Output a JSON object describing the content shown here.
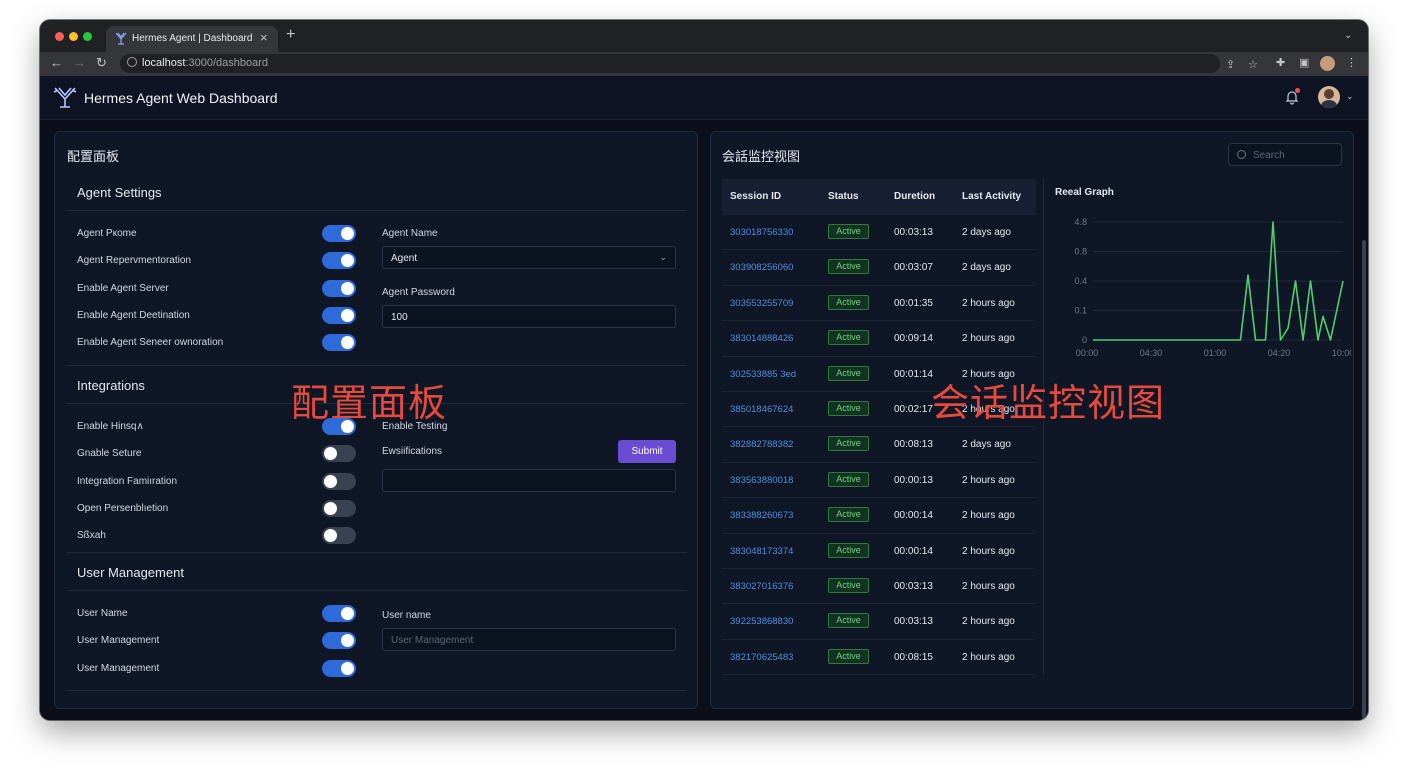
{
  "browser": {
    "tab_title": "Hermes Agent | Dashboard",
    "tab_close": "×",
    "new_tab": "+",
    "url_host": "localhost",
    "url_path": ":3000/dashboard"
  },
  "header": {
    "title": "Hermes Agent Web Dashboard"
  },
  "config_panel": {
    "title": "配置面板",
    "overlay_label": "配置面板",
    "agent_settings": {
      "title": "Agent Settings",
      "toggles": [
        {
          "label": "Agent Pкоme",
          "on": true
        },
        {
          "label": "Agent Repervmentoration",
          "on": true
        },
        {
          "label": "Enable Agent Server",
          "on": true
        },
        {
          "label": "Enable Agent Deetination",
          "on": true
        },
        {
          "label": "Enable Agent Seneer ownoration",
          "on": true
        }
      ],
      "agent_name_label": "Agent Name",
      "agent_name_value": "Agent",
      "agent_password_label": "Agent Password",
      "agent_password_value": "100"
    },
    "integrations": {
      "title": "Integrations",
      "toggles": [
        {
          "label": "Enable Hinsq∧",
          "on": true
        },
        {
          "label": "Gnable Seture",
          "on": false
        },
        {
          "label": "Integration Famiıration",
          "on": false
        },
        {
          "label": "Open Persenblıetion",
          "on": false
        },
        {
          "label": "Sßxah",
          "on": false
        }
      ],
      "enable_testing_label": "Enable Testing",
      "ewsiifications_label": "Ewsiifications",
      "submit_label": "Submit",
      "notes_value": ""
    },
    "user_management": {
      "title": "User Management",
      "toggles": [
        {
          "label": "User Name",
          "on": true
        },
        {
          "label": "User Management",
          "on": true
        },
        {
          "label": "User Management",
          "on": true
        }
      ],
      "user_name_label": "User name",
      "user_name_placeholder": "User Management"
    }
  },
  "session_panel": {
    "title": "会話监控视图",
    "overlay_label": "会话监控视图",
    "search_placeholder": "Search",
    "columns": [
      "Session ID",
      "Status",
      "Duretion",
      "Last Activity"
    ],
    "rows": [
      {
        "id": "303018756330",
        "status": "Active",
        "duration": "00:03:13",
        "last": "2 days ago"
      },
      {
        "id": "303908256060",
        "status": "Active",
        "duration": "00:03:07",
        "last": "2 days ago"
      },
      {
        "id": "303553255709",
        "status": "Active",
        "duration": "00:01:35",
        "last": "2 hours ago"
      },
      {
        "id": "383014888426",
        "status": "Active",
        "duration": "00:09:14",
        "last": "2 hours ago"
      },
      {
        "id": "302533885 3ed",
        "status": "Active",
        "duration": "00:01:14",
        "last": "2 hours ago"
      },
      {
        "id": "385018467624",
        "status": "Active",
        "duration": "00:02:17",
        "last": "2 hours ago"
      },
      {
        "id": "382882788382",
        "status": "Active",
        "duration": "00:08:13",
        "last": "2 days ago"
      },
      {
        "id": "383563880018",
        "status": "Active",
        "duration": "00:00:13",
        "last": "2 hours ago"
      },
      {
        "id": "383388260673",
        "status": "Active",
        "duration": "00:00:14",
        "last": "2 hours ago"
      },
      {
        "id": "383048173374",
        "status": "Active",
        "duration": "00:00:14",
        "last": "2 hours ago"
      },
      {
        "id": "383027016376",
        "status": "Active",
        "duration": "00:03:13",
        "last": "2 hours ago"
      },
      {
        "id": "392253868830",
        "status": "Active",
        "duration": "00:03:13",
        "last": "2 hours ago"
      },
      {
        "id": "382170625483",
        "status": "Active",
        "duration": "00:08:15",
        "last": "2 hours ago"
      }
    ],
    "graph_title": "Reeal Graph",
    "colors": {
      "accent": "#2e6bd8",
      "graph_line": "#4fce6a",
      "submit": "#6a4bd4",
      "overlay": "#e64a3c"
    }
  },
  "chart_data": {
    "type": "line",
    "title": "Reeal Graph",
    "y_ticks": [
      "4.8",
      "0.8",
      "0.4",
      "0.1",
      "0"
    ],
    "x_ticks": [
      "00:00",
      "04:30",
      "01:00",
      "04:20",
      "10:00"
    ],
    "series": [
      {
        "values": [
          [
            0,
            0.0
          ],
          [
            0.59,
            0.0
          ],
          [
            0.62,
            0.55
          ],
          [
            0.65,
            0.0
          ],
          [
            0.69,
            0.0
          ],
          [
            0.72,
            1.0
          ],
          [
            0.75,
            0.0
          ],
          [
            0.78,
            0.1
          ],
          [
            0.81,
            0.5
          ],
          [
            0.84,
            0.0
          ],
          [
            0.87,
            0.5
          ],
          [
            0.9,
            0.0
          ],
          [
            0.92,
            0.2
          ],
          [
            0.95,
            0.0
          ],
          [
            1.0,
            0.5
          ]
        ]
      }
    ],
    "grid": true
  }
}
